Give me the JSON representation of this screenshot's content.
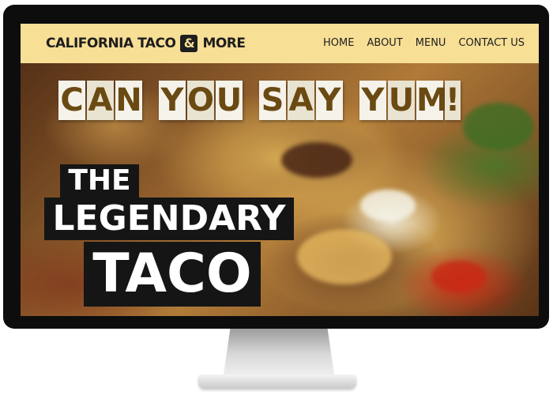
{
  "nav": {
    "brand_left": "CALIFORNIA TACO",
    "brand_amp": "&",
    "brand_right": "MORE",
    "links": [
      "HOME",
      "ABOUT",
      "MENU",
      "CONTACT US"
    ]
  },
  "hero": {
    "headline_words": [
      "CAN",
      "YOU",
      "SAY",
      "YUM!"
    ],
    "line1": "THE",
    "line2": "LEGENDARY",
    "line3": "TACO"
  },
  "colors": {
    "nav_bg": "#f8df96",
    "text_dark": "#1e1e1e",
    "tile_bg": "#f5f2ea",
    "hero_block": "#151515"
  }
}
